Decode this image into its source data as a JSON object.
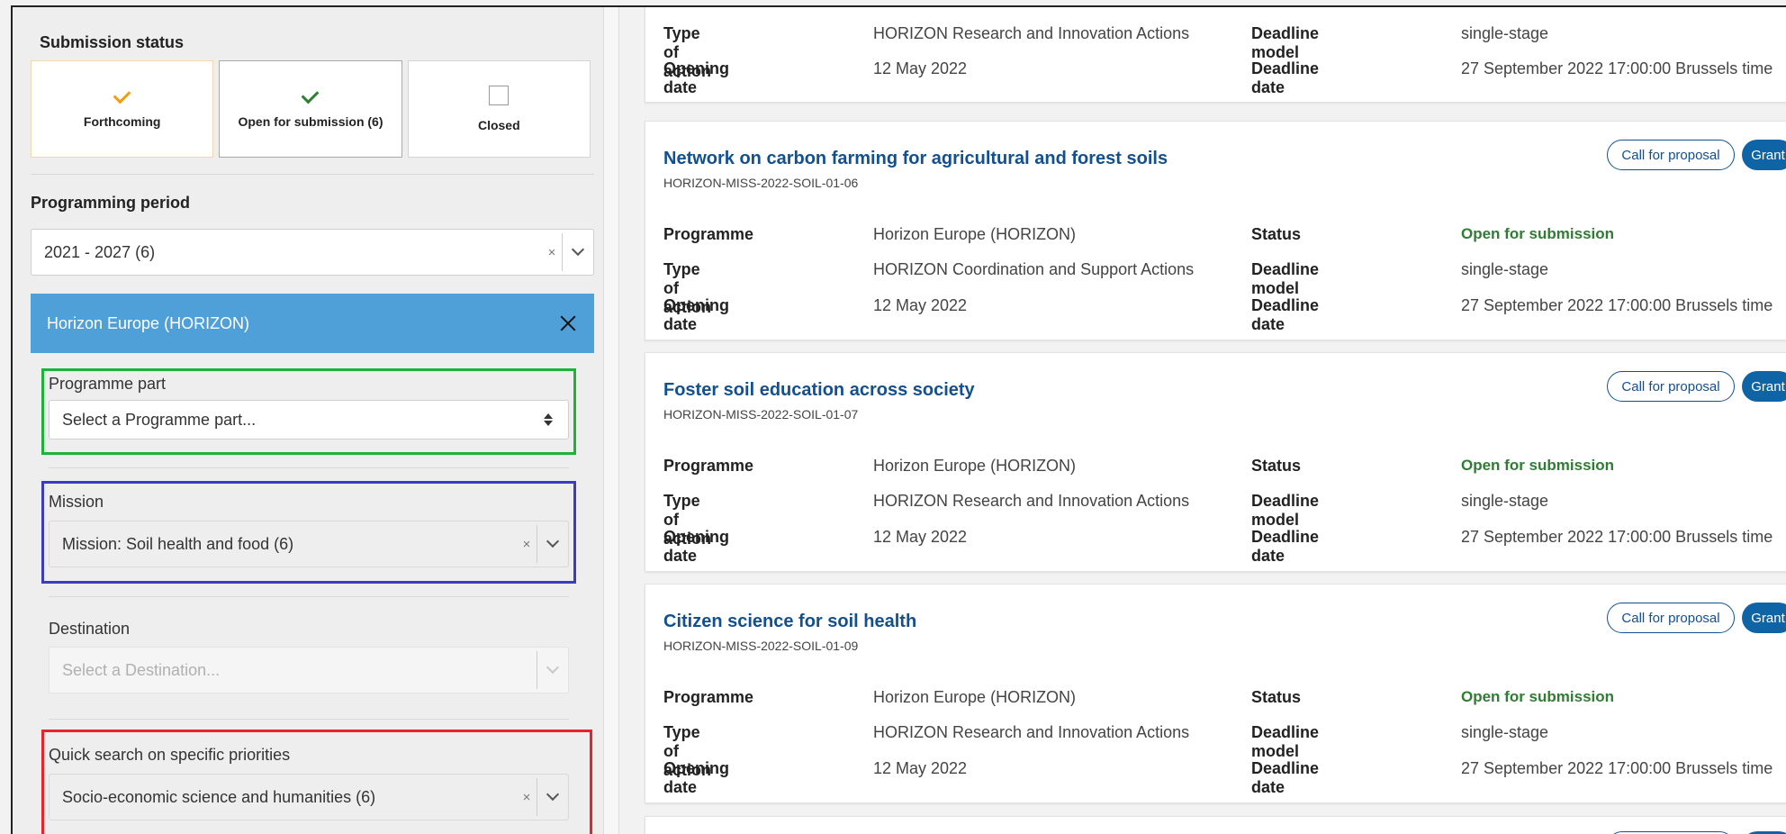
{
  "sidebar": {
    "submission_status_title": "Submission status",
    "status_cards": [
      {
        "label": "Forthcoming",
        "icon": "check-icon"
      },
      {
        "label": "Open for submission (6)",
        "icon": "check-icon"
      },
      {
        "label": "Closed",
        "icon": "checkbox-icon"
      }
    ],
    "programming_period_title": "Programming period",
    "programming_period_value": "2021 - 2027 (6)",
    "programme_header": "Horizon Europe (HORIZON)",
    "programme_part_label": "Programme part",
    "programme_part_placeholder": "Select a Programme part...",
    "mission_label": "Mission",
    "mission_value": "Mission: Soil health and food (6)",
    "destination_label": "Destination",
    "destination_placeholder": "Select a Destination...",
    "quick_search_label": "Quick search on specific priorities",
    "quick_search_value": "Socio-economic science and humanities (6)",
    "clear_symbol": "×"
  },
  "labels": {
    "programme": "Programme",
    "type_of_action": "Type of action",
    "opening_date": "Opening date",
    "status": "Status",
    "deadline_model": "Deadline model",
    "deadline_date": "Deadline date",
    "call_for_proposal": "Call for proposal",
    "grant": "Grant"
  },
  "partial_card": {
    "type_of_action": "HORIZON Research and Innovation Actions",
    "opening_date": "12 May 2022",
    "deadline_model": "single-stage",
    "deadline_date": "27 September 2022 17:00:00 Brussels time"
  },
  "cards": [
    {
      "title": "Network on carbon farming for agricultural and forest soils",
      "id": "HORIZON-MISS-2022-SOIL-01-06",
      "programme": "Horizon Europe (HORIZON)",
      "type_of_action": "HORIZON Coordination and Support Actions",
      "opening_date": "12 May 2022",
      "status": "Open for submission",
      "deadline_model": "single-stage",
      "deadline_date": "27 September 2022 17:00:00 Brussels time"
    },
    {
      "title": "Foster soil education across society",
      "id": "HORIZON-MISS-2022-SOIL-01-07",
      "programme": "Horizon Europe (HORIZON)",
      "type_of_action": "HORIZON Research and Innovation Actions",
      "opening_date": "12 May 2022",
      "status": "Open for submission",
      "deadline_model": "single-stage",
      "deadline_date": "27 September 2022 17:00:00 Brussels time"
    },
    {
      "title": "Citizen science for soil health",
      "id": "HORIZON-MISS-2022-SOIL-01-09",
      "programme": "Horizon Europe (HORIZON)",
      "type_of_action": "HORIZON Research and Innovation Actions",
      "opening_date": "12 May 2022",
      "status": "Open for submission",
      "deadline_model": "single-stage",
      "deadline_date": "27 September 2022 17:00:00 Brussels time"
    }
  ],
  "colors": {
    "accent": "#4f9fd8",
    "link": "#12508f",
    "status_open": "#2e7d32",
    "highlight_green": "#1fb23a",
    "highlight_blue": "#3c3cc0",
    "highlight_red": "#e8232a"
  }
}
